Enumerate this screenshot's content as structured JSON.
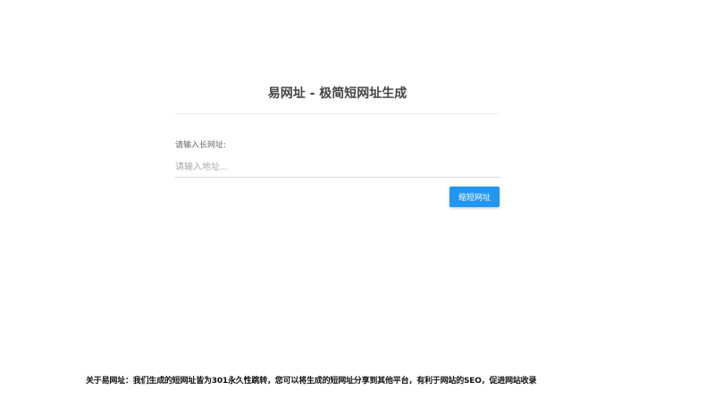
{
  "header": {
    "title": "易网址 - 极简短网址生成"
  },
  "form": {
    "field_label": "请输入长网址:",
    "url_input": {
      "value": "",
      "placeholder": "请输入地址..."
    },
    "submit_label": "缩短网址"
  },
  "footer": {
    "note": "关于易网址：我们生成的短网址皆为301永久性跳转，您可以将生成的短网址分享到其他平台，有利于网站的SEO，促进网站收录"
  },
  "colors": {
    "accent": "#2196f3",
    "title_text": "#444444",
    "divider": "#eeeeee"
  }
}
